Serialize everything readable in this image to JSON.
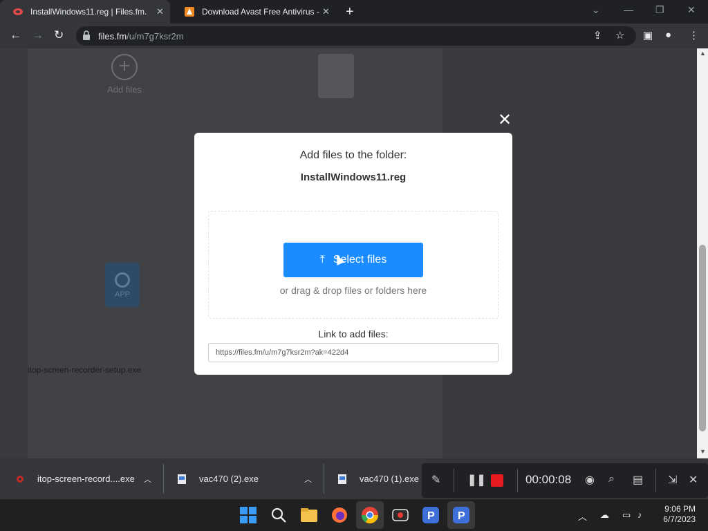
{
  "browser": {
    "tabs": [
      {
        "title": "InstallWindows11.reg | Files.fm.",
        "active": true
      },
      {
        "title": "Download Avast Free Antivirus -",
        "active": false
      }
    ],
    "url_host": "files.fm",
    "url_path": "/u/m7g7ksr2m"
  },
  "page": {
    "add_files_label": "Add files",
    "app_icon_label": "APP",
    "app_filename": "itop-screen-recorder-setup.exe"
  },
  "modal": {
    "heading": "Add files to the folder:",
    "folder_name": "InstallWindows11.reg",
    "select_button_label": "Select files",
    "drag_hint": "or drag & drop files or folders here",
    "link_label": "Link to add files:",
    "link_value": "https://files.fm/u/m7g7ksr2m?ak=422d4"
  },
  "downloads": [
    {
      "name": "itop-screen-record....exe"
    },
    {
      "name": "vac470 (2).exe"
    },
    {
      "name": "vac470 (1).exe"
    }
  ],
  "recorder": {
    "elapsed": "00:00:08"
  },
  "taskbar": {
    "time": "9:06 PM",
    "date": "6/7/2023"
  },
  "colors": {
    "accent_button": "#1a8cff",
    "record_stop": "#e81b23"
  }
}
